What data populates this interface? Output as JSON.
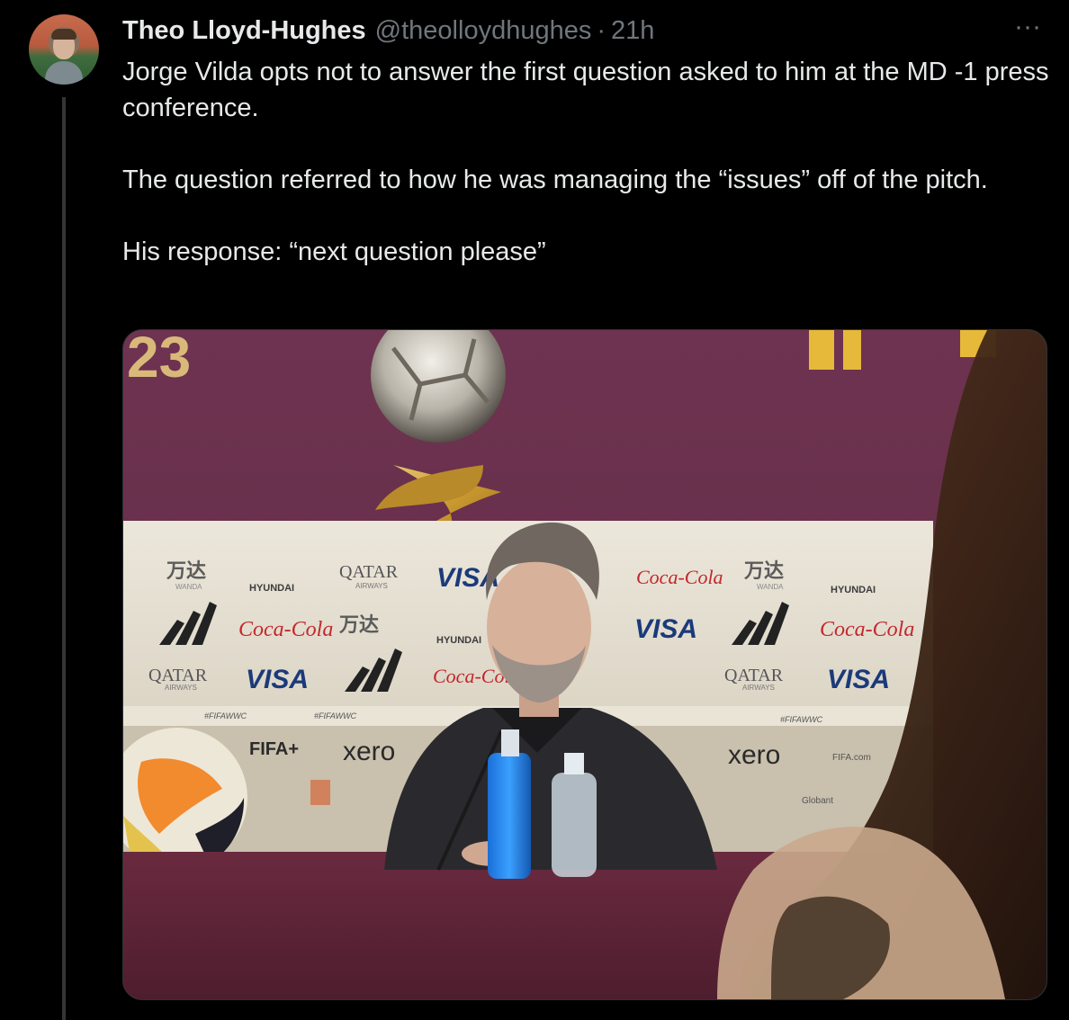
{
  "author": {
    "display_name": "Theo Lloyd-Hughes",
    "handle": "@theolloydhughes",
    "separator": "·",
    "timestamp": "21h"
  },
  "more_glyph": "···",
  "tweet": {
    "paragraphs": [
      "Jorge Vilda opts not to answer the first question asked to him at the MD -1 press conference.",
      "The question referred to how he was managing the “issues” off of the pitch.",
      "His response: “next question please”"
    ]
  },
  "media": {
    "banner_text": "23",
    "sponsors": {
      "qatar": "QATAR",
      "airways": "AIRWAYS",
      "visa": "VISA",
      "hyundai": "HYUNDAI",
      "coca_cola": "Coca-Cola",
      "wanda": "WANDA",
      "wanda_cn": "万达",
      "fifa_plus": "FIFA+",
      "xero": "xero",
      "hashtag": "#FIFAWWC",
      "globant": "Globant",
      "fifa_com": "FIFA.com"
    }
  },
  "colors": {
    "background": "#000000",
    "text_primary": "#e7e9ea",
    "text_secondary": "#71767b",
    "thread_line": "#333639",
    "backdrop_purple": "#6b2f4a",
    "desk": "#5a2233"
  }
}
